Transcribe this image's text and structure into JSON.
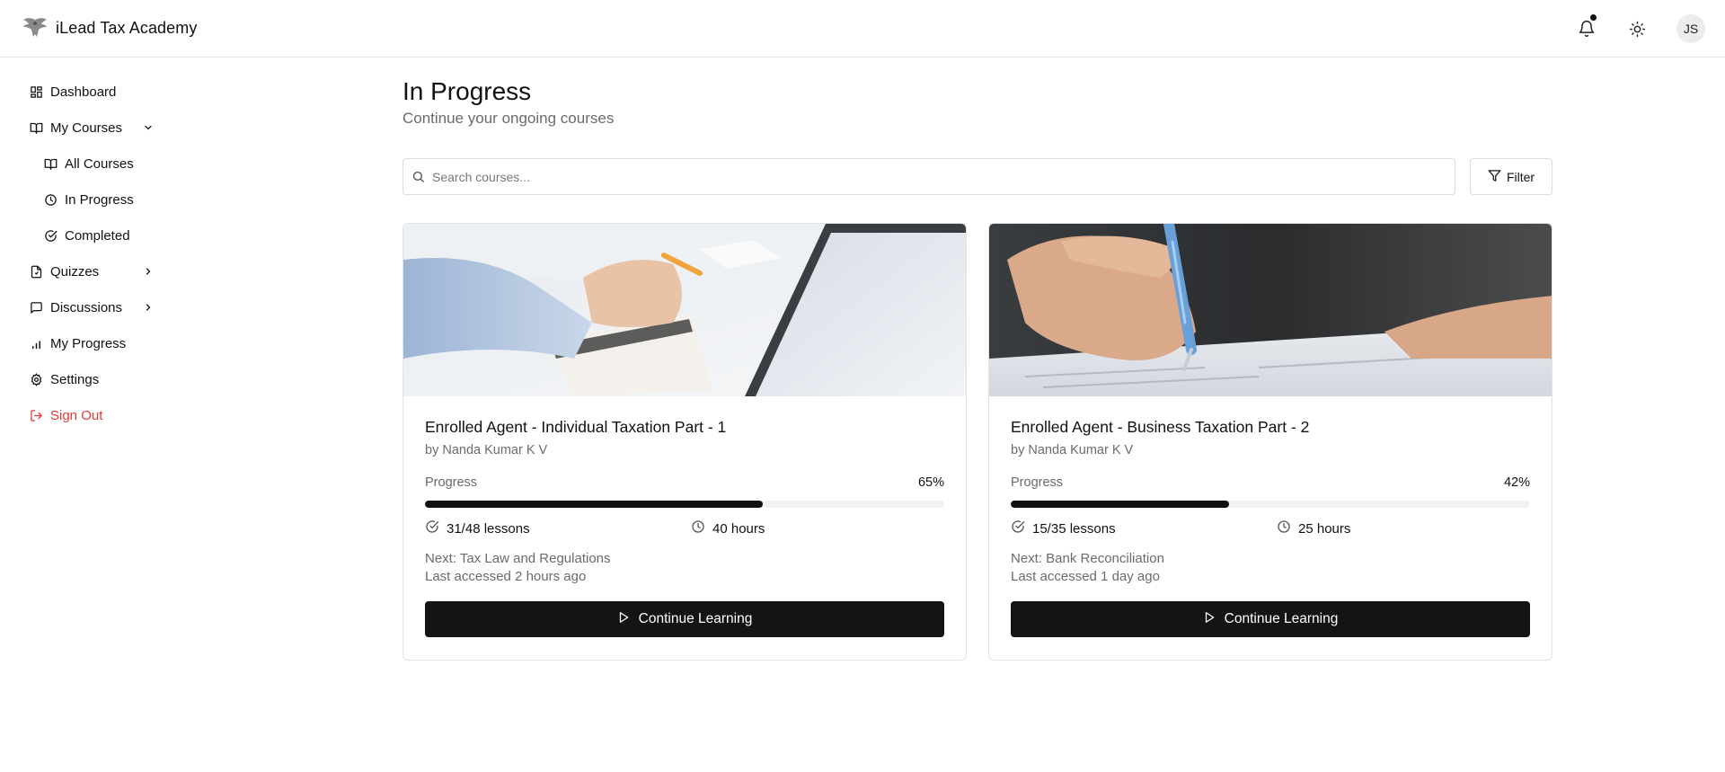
{
  "header": {
    "brand_name": "iLead Tax Academy",
    "avatar_initials": "JS",
    "has_unread_notifications": true
  },
  "sidebar": {
    "items": [
      {
        "label": "Dashboard",
        "icon": "dashboard-icon"
      },
      {
        "label": "My Courses",
        "icon": "book-open-icon",
        "expanded": true
      },
      {
        "label": "All Courses",
        "icon": "book-open-icon",
        "sub": true
      },
      {
        "label": "In Progress",
        "icon": "clock-icon",
        "sub": true,
        "active": true
      },
      {
        "label": "Completed",
        "icon": "check-circle-icon",
        "sub": true
      },
      {
        "label": "Quizzes",
        "icon": "file-icon"
      },
      {
        "label": "Discussions",
        "icon": "message-square-icon"
      },
      {
        "label": "My Progress",
        "icon": "bar-chart-icon"
      },
      {
        "label": "Settings",
        "icon": "gear-icon"
      },
      {
        "label": "Sign Out",
        "icon": "log-out-icon",
        "color": "#e53935"
      }
    ]
  },
  "main": {
    "title": "In Progress",
    "subtitle": "Continue your ongoing courses",
    "search_placeholder": "Search courses...",
    "search_value": "",
    "filter_label": "Filter"
  },
  "courses": [
    {
      "title": "Enrolled Agent - Individual Taxation Part - 1",
      "author": "by Nanda Kumar K V",
      "progress_label": "Progress",
      "progress_text": "65%",
      "progress_fraction": 0.65,
      "lessons": "31/48 lessons",
      "hours": "40 hours",
      "next": "Next: Tax Law and Regulations",
      "last_accessed": "Last accessed 2 hours ago",
      "cta": "Continue Learning"
    },
    {
      "title": "Enrolled Agent - Business Taxation Part - 2",
      "author": "by Nanda Kumar K V",
      "progress_label": "Progress",
      "progress_text": "42%",
      "progress_fraction": 0.42,
      "lessons": "15/35 lessons",
      "hours": "25 hours",
      "next": "Next: Bank Reconciliation",
      "last_accessed": "Last accessed 1 day ago",
      "cta": "Continue Learning"
    }
  ],
  "colors": {
    "accent": "#141414",
    "danger": "#e53935",
    "muted_text": "#6b6b6b",
    "border": "#e3e3e3"
  }
}
